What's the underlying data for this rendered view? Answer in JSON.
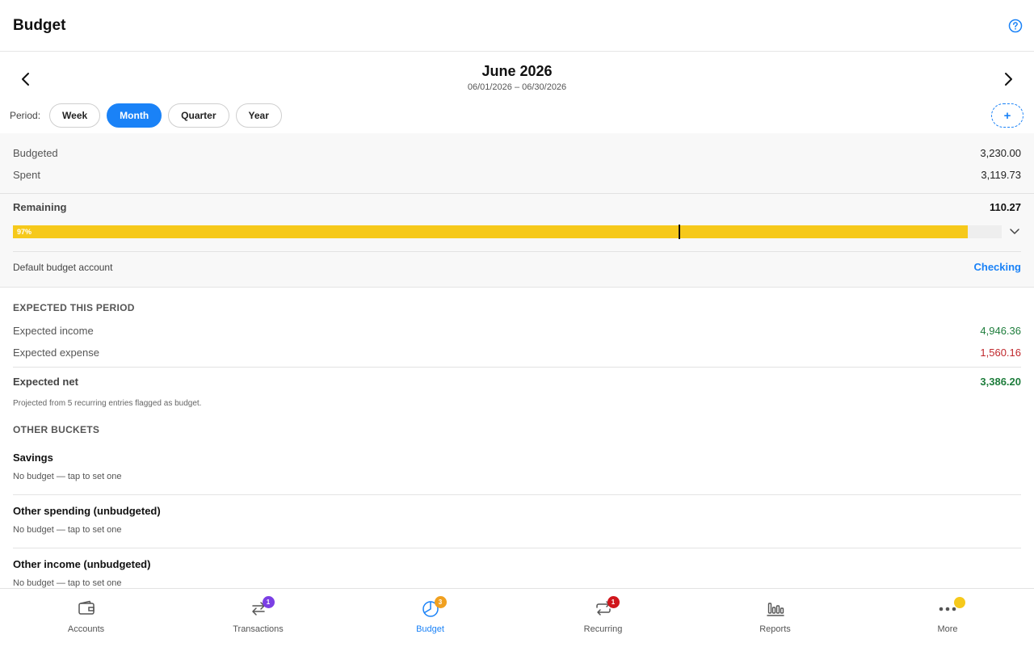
{
  "header": {
    "title": "Budget",
    "help_icon": "question-circle-icon"
  },
  "period": {
    "title": "June 2026",
    "range": "06/01/2026 – 06/30/2026",
    "label": "Period:",
    "options": [
      "Week",
      "Month",
      "Quarter",
      "Year"
    ],
    "selected": "Month",
    "add_label": "+"
  },
  "summary": {
    "budgeted_label": "Budgeted",
    "budgeted_value": "3,230.00",
    "spent_label": "Spent",
    "spent_value": "3,119.73",
    "remaining_label": "Remaining",
    "remaining_value": "110.27",
    "progress_percent_label": "97%",
    "progress_fraction": 0.966,
    "period_elapsed_fraction": 0.673,
    "progress_color": "#f6c91b",
    "default_account_label": "Default budget account",
    "default_account_value": "Checking"
  },
  "expected": {
    "heading": "EXPECTED THIS PERIOD",
    "income_label": "Expected income",
    "income_value": "4,946.36",
    "expense_label": "Expected expense",
    "expense_value": "1,560.16",
    "net_label": "Expected net",
    "net_value": "3,386.20",
    "note": "Projected from 5 recurring entries flagged as budget.",
    "income_color": "#1e7d3c",
    "expense_color": "#c0282d"
  },
  "other": {
    "heading": "OTHER BUCKETS",
    "buckets": [
      {
        "name": "Savings",
        "sub": "No budget — tap to set one"
      },
      {
        "name": "Other spending (unbudgeted)",
        "sub": "No budget — tap to set one"
      },
      {
        "name": "Other income (unbudgeted)",
        "sub": "No budget — tap to set one"
      }
    ]
  },
  "tabs": [
    {
      "label": "Accounts",
      "icon": "wallet-icon",
      "badge": ""
    },
    {
      "label": "Transactions",
      "icon": "transfer-arrows-icon",
      "badge": "1",
      "badge_color": "#7b3fe4"
    },
    {
      "label": "Budget",
      "icon": "pie-chart-icon",
      "badge": "3",
      "badge_color": "#f0a020",
      "active": true
    },
    {
      "label": "Recurring",
      "icon": "repeat-icon",
      "badge": "1",
      "badge_color": "#d0161c"
    },
    {
      "label": "Reports",
      "icon": "bar-chart-icon",
      "badge": ""
    },
    {
      "label": "More",
      "icon": "more-dots-icon",
      "dot_color": "#f6c91b"
    }
  ]
}
